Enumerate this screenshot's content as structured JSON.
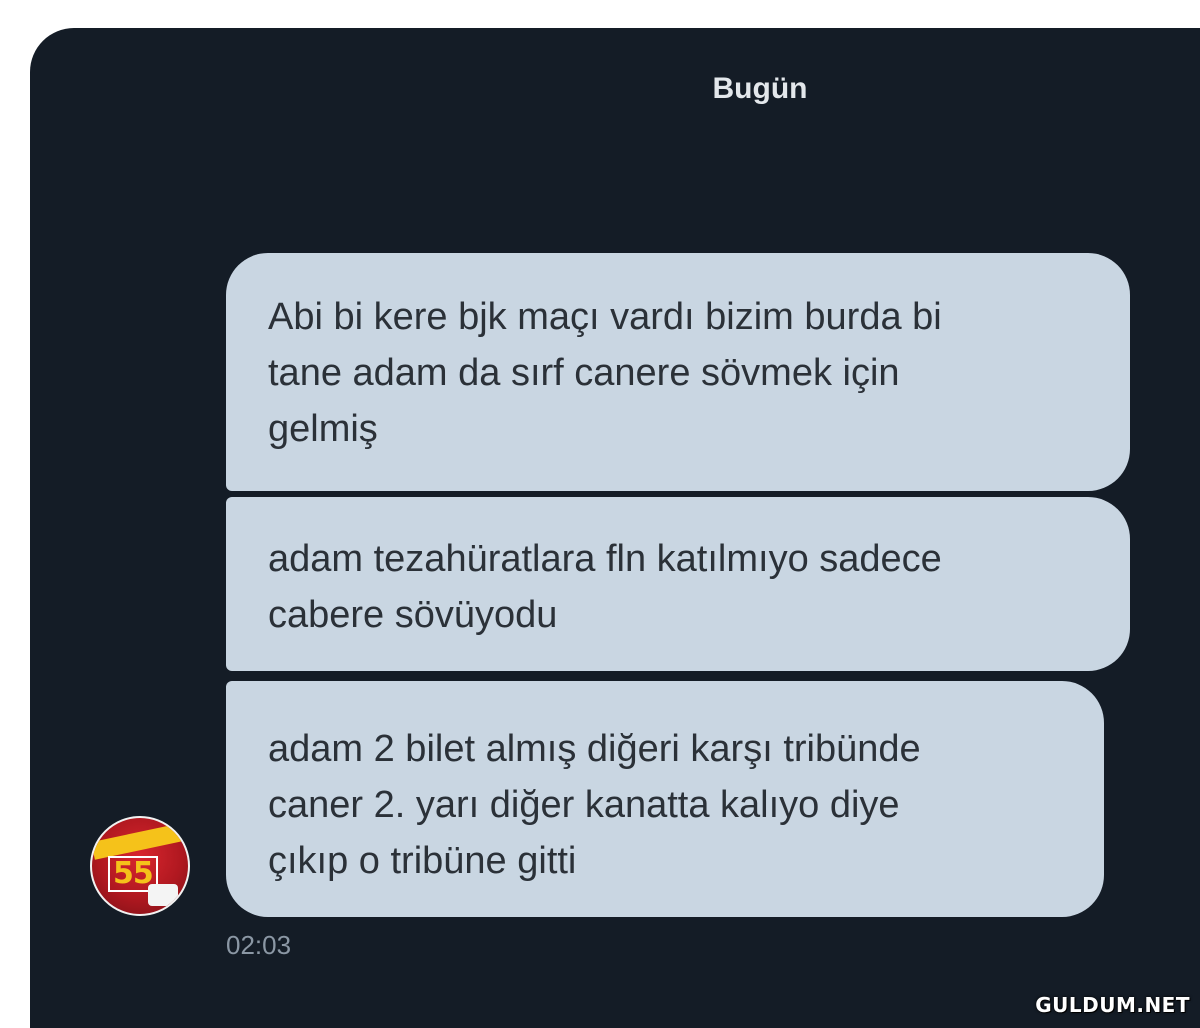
{
  "conversation": {
    "date_separator": "Bugün",
    "messages": [
      {
        "lines": [
          "Abi bi kere bjk maçı vardı bizim burda bi",
          "tane adam da sırf canere sövmek için",
          "gelmiş"
        ]
      },
      {
        "lines": [
          "adam tezahüratlara fln katılmıyo sadece",
          "cabere sövüyodu"
        ]
      },
      {
        "lines": [
          "adam 2 bilet almış diğeri karşı tribünde",
          "caner 2. yarı diğer kanatta kalıyo diye",
          "çıkıp o tribüne gitti"
        ]
      }
    ],
    "timestamp": "02:03",
    "avatar": {
      "jersey_number": "55",
      "colors": [
        "#d8262e",
        "#f5c21a"
      ]
    }
  },
  "theme": {
    "background": "#141c26",
    "bubble": "#c9d6e2",
    "text": "#2b3138"
  },
  "watermark": "GULDUM.NET"
}
